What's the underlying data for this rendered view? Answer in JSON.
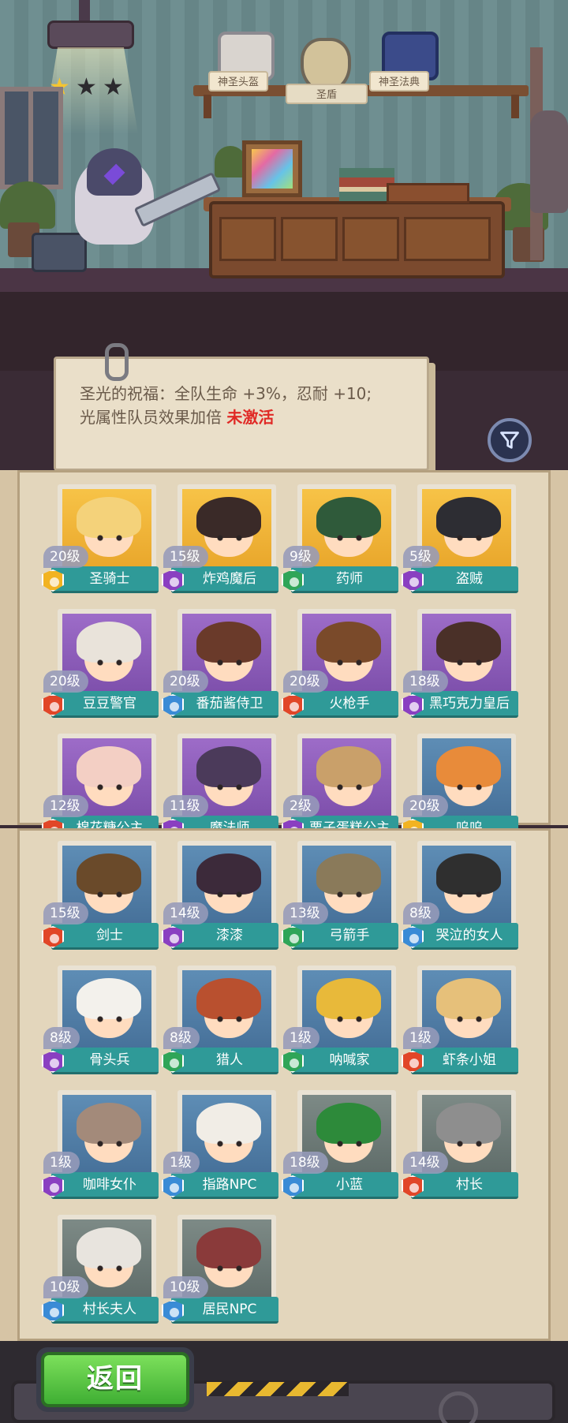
{
  "stars": {
    "filled": 1,
    "total": 3
  },
  "relics": [
    {
      "label": "神圣头盔",
      "icon": "holy-helmet-icon",
      "selected": false
    },
    {
      "label": "圣盾",
      "icon": "holy-shield-icon",
      "selected": true
    },
    {
      "label": "神圣法典",
      "icon": "holy-codex-icon",
      "selected": false
    }
  ],
  "bonus": {
    "line1": "圣光的祝福：全队生命 +3%，忍耐 +10;",
    "line2_prefix": "光属性队员效果加倍 ",
    "status": "未激活"
  },
  "filter_icon": "filter-icon",
  "roster_page1": [
    {
      "name": "圣骑士",
      "level": "20级",
      "element": "light",
      "frame": "gold"
    },
    {
      "name": "炸鸡魔后",
      "level": "15级",
      "element": "shadow",
      "frame": "gold"
    },
    {
      "name": "药师",
      "level": "9级",
      "element": "nature",
      "frame": "gold"
    },
    {
      "name": "盗贼",
      "level": "5级",
      "element": "shadow",
      "frame": "gold"
    },
    {
      "name": "豆豆警官",
      "level": "20级",
      "element": "fire",
      "frame": "purple"
    },
    {
      "name": "番茄酱侍卫",
      "level": "20级",
      "element": "water",
      "frame": "purple"
    },
    {
      "name": "火枪手",
      "level": "20级",
      "element": "fire",
      "frame": "purple"
    },
    {
      "name": "黑巧克力皇后",
      "level": "18级",
      "element": "shadow",
      "frame": "purple"
    },
    {
      "name": "棉花糖公主",
      "level": "12级",
      "element": "fire",
      "frame": "purple"
    },
    {
      "name": "魔法师",
      "level": "11级",
      "element": "shadow",
      "frame": "purple"
    },
    {
      "name": "栗子蛋糕公主",
      "level": "2级",
      "element": "shadow",
      "frame": "purple"
    },
    {
      "name": "呜呜",
      "level": "20级",
      "element": "light",
      "frame": "blue"
    }
  ],
  "roster_page2": [
    {
      "name": "剑士",
      "level": "15级",
      "element": "fire",
      "frame": "blue"
    },
    {
      "name": "漆漆",
      "level": "14级",
      "element": "shadow",
      "frame": "blue"
    },
    {
      "name": "弓箭手",
      "level": "13级",
      "element": "nature",
      "frame": "blue"
    },
    {
      "name": "哭泣的女人",
      "level": "8级",
      "element": "water",
      "frame": "blue"
    },
    {
      "name": "骨头兵",
      "level": "8级",
      "element": "shadow",
      "frame": "blue"
    },
    {
      "name": "猎人",
      "level": "8级",
      "element": "nature",
      "frame": "blue"
    },
    {
      "name": "呐喊家",
      "level": "1级",
      "element": "nature",
      "frame": "blue"
    },
    {
      "name": "虾条小姐",
      "level": "1级",
      "element": "fire",
      "frame": "blue"
    },
    {
      "name": "咖啡女仆",
      "level": "1级",
      "element": "shadow",
      "frame": "blue"
    },
    {
      "name": "指路NPC",
      "level": "1级",
      "element": "water",
      "frame": "blue"
    },
    {
      "name": "小蓝",
      "level": "18级",
      "element": "water",
      "frame": "grey"
    },
    {
      "name": "村长",
      "level": "14级",
      "element": "fire",
      "frame": "grey"
    },
    {
      "name": "村长夫人",
      "level": "10级",
      "element": "water",
      "frame": "grey"
    },
    {
      "name": "居民NPC",
      "level": "10级",
      "element": "water",
      "frame": "grey"
    }
  ],
  "back_button": {
    "label": "返回"
  },
  "colors": {
    "inactive": "#e02a26",
    "name_bar": "#2f9a98",
    "back_green": "#4fc03d"
  }
}
